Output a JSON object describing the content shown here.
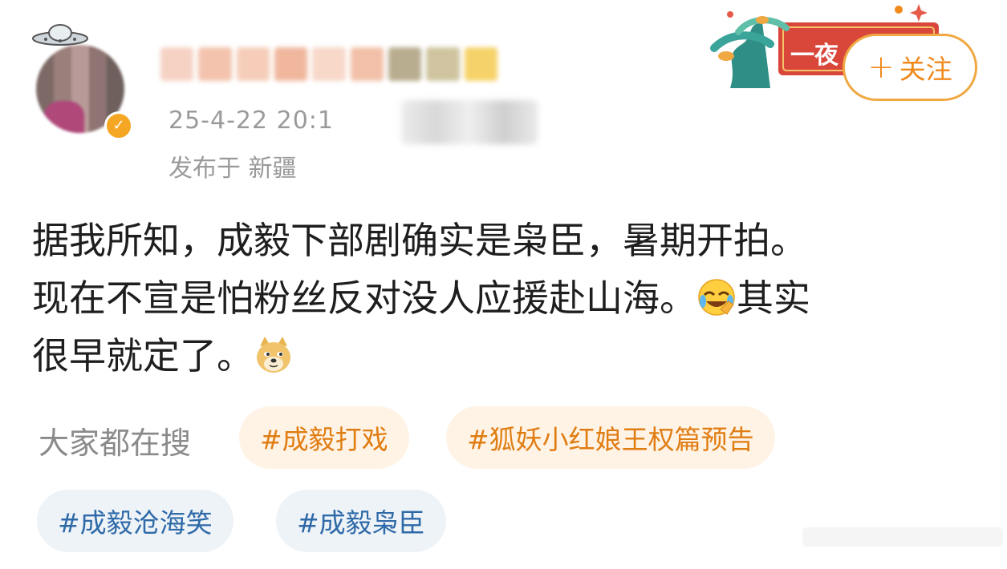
{
  "post": {
    "timestamp_visible": "25-4-22 20:1",
    "location": "发布于 新疆",
    "follow_button": {
      "icon": "plus-icon",
      "label": "关注"
    },
    "decoration_label": "一夜",
    "content": {
      "line1": "据我所知，成毅下部剧确实是枭臣，暑期开拍。",
      "line2_text": "现在不宣是怕粉丝反对没人应援赴山海。",
      "line2_emoji": "laughing-crying-emoji",
      "line2_tail": "其实",
      "line3_text": "很早就定了。",
      "line3_emoji": "doge-emoji"
    }
  },
  "hot_search": {
    "label": "大家都在搜",
    "tags": [
      {
        "text": "#成毅打戏",
        "style": "orange"
      },
      {
        "text": "#狐妖小红娘王权篇预告",
        "style": "orange"
      },
      {
        "text": "#成毅沧海笑",
        "style": "blue"
      },
      {
        "text": "#成毅枭臣",
        "style": "blue"
      }
    ]
  },
  "colors": {
    "accent": "#f08a1c",
    "tag_orange_bg": "#fff3e6",
    "tag_blue_bg": "#eef3f8",
    "tag_blue_text": "#2f6aa8",
    "muted_text": "#9a9a9a"
  }
}
